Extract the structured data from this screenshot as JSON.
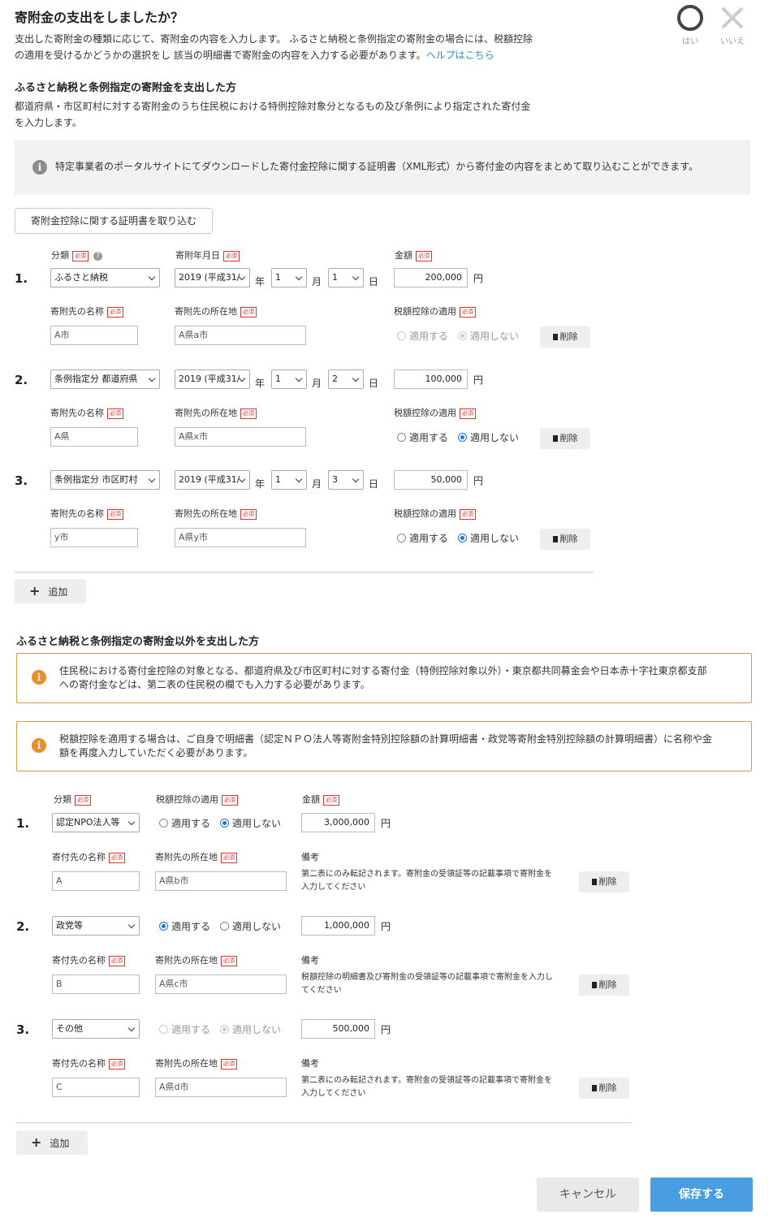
{
  "header": {
    "title": "寄附金の支出をしましたか？",
    "intro_line1": "支出した寄附金の種類に応じて、寄附金の内容を入力します。 ふるさと納税と条例指定の寄附金の場合には、税額控除",
    "intro_line2": "の適用を受けるかどうかの選択をし 該当の明細書で寄附金の内容を入力する必要があります。",
    "help_link": "ヘルプはこちら",
    "yes_label": "はい",
    "no_label": "いいえ"
  },
  "section1": {
    "title": "ふるさと納税と条例指定の寄附金を支出した方",
    "desc_line1": "都道府県・市区町村に対する寄附金のうち住民税における特例控除対象分となるもの及び条例により指定された寄付金",
    "desc_line2": "を入力します。",
    "info_text": "特定事業者のポータルサイトにてダウンロードした寄付金控除に関する証明書（XML形式）から寄付金の内容をまとめて取り込むことができます。",
    "import_button": "寄附金控除に関する証明書を取り込む",
    "labels": {
      "category": "分類",
      "date": "寄附年月日",
      "amount": "金額",
      "name": "寄附先の名称",
      "address": "寄附先の所在地",
      "tax_credit": "税額控除の適用",
      "required": "必須",
      "year_unit": "年",
      "month_unit": "月",
      "day_unit": "日",
      "yen": "円",
      "apply": "適用する",
      "not_apply": "適用しない",
      "delete": "削除"
    },
    "rows": [
      {
        "num": "1.",
        "category": "ふるさと納税",
        "year": "2019 (平成31/",
        "month": "1",
        "day": "1",
        "amount": "200,000",
        "name": "A市",
        "address": "A県a市"
      },
      {
        "num": "2.",
        "category": "条例指定分 都道府県",
        "year": "2019 (平成31/",
        "month": "1",
        "day": "2",
        "amount": "100,000",
        "name": "A県",
        "address": "A県x市"
      },
      {
        "num": "3.",
        "category": "条例指定分 市区町村",
        "year": "2019 (平成31/",
        "month": "1",
        "day": "3",
        "amount": "50,000",
        "name": "y市",
        "address": "A県y市"
      }
    ],
    "add_button": "追加"
  },
  "section2": {
    "title": "ふるさと納税と条例指定の寄附金以外を支出した方",
    "notice1_line1": "住民税における寄付金控除の対象となる、都道府県及び市区町村に対する寄付金（特例控除対象以外）・東京都共同募金会や日本赤十字社東京都支部",
    "notice1_line2": "への寄付金などは、第二表の住民税の欄でも入力する必要があります。",
    "notice2_line1": "税額控除を適用する場合は、ご自身で明細書（認定ＮＰＯ法人等寄附金特別控除額の計算明細書・政党等寄附金特別控除額の計算明細書）に名称や金",
    "notice2_line2": "額を再度入力していただく必要があります。",
    "labels": {
      "category": "分類",
      "tax_credit": "税額控除の適用",
      "amount": "金額",
      "name": "寄付先の名称",
      "address": "寄附先の所在地",
      "remarks": "備考",
      "required": "必須",
      "yen": "円",
      "apply": "適用する",
      "not_apply": "適用しない",
      "delete": "削除"
    },
    "rows": [
      {
        "num": "1.",
        "category": "認定NPO法人等",
        "amount": "3,000,000",
        "name": "A",
        "address": "A県b市",
        "note1": "第二表にのみ転記されます。寄附金の受領証等の記載事項で寄附金を",
        "note2": "入力してください"
      },
      {
        "num": "2.",
        "category": "政党等",
        "amount": "1,000,000",
        "name": "B",
        "address": "A県c市",
        "note1": "税額控除の明細書及び寄附金の受領証等の記載事項で寄附金を入力し",
        "note2": "てください"
      },
      {
        "num": "3.",
        "category": "その他",
        "amount": "500,000",
        "name": "C",
        "address": "A県d市",
        "note1": "第二表にのみ転記されます。寄附金の受領証等の記載事項で寄附金を",
        "note2": "入力してください"
      }
    ],
    "add_button": "追加"
  },
  "footer": {
    "cancel": "キャンセル",
    "save": "保存する"
  },
  "colors": {
    "link": "#2a8bd8",
    "primary": "#4a9de0",
    "required": "#d33333",
    "notice_border": "#d29a4a",
    "notice_icon": "#e8912c"
  }
}
